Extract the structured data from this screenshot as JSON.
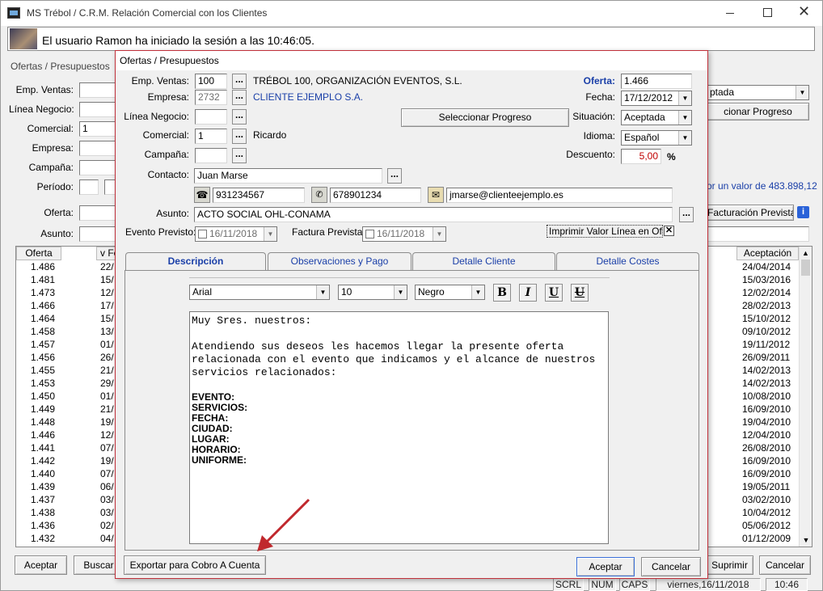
{
  "window": {
    "title": "MS Trébol / C.R.M. Relación Comercial con los  Clientes"
  },
  "banner": {
    "message": "El usuario Ramon ha iniciado la sesión a las 10:46:05."
  },
  "back": {
    "section_title": "Ofertas / Presupuestos",
    "labels": {
      "emp_ventas": "Emp. Ventas:",
      "linea_negocio": "Línea Negocio:",
      "comercial": "Comercial:",
      "empresa": "Empresa:",
      "campana": "Campaña:",
      "periodo": "Período:",
      "oferta": "Oferta:",
      "asunto": "Asunto:"
    },
    "comercial_value": "1",
    "situacion_partial": "ptada",
    "progreso_partial": "cionar Progreso",
    "total_text": "or un valor de 483.898,12",
    "facturacion_button": "Facturación Prevista",
    "columns": {
      "oferta": "Oferta",
      "fecha_partial": "v Fe",
      "aceptacion": "Aceptación"
    },
    "rows": [
      {
        "oferta": "1.486",
        "fecha": "22/",
        "aceptacion": "24/04/2014"
      },
      {
        "oferta": "1.481",
        "fecha": "15/",
        "aceptacion": "15/03/2016"
      },
      {
        "oferta": "1.473",
        "fecha": "12/",
        "aceptacion": "12/02/2014"
      },
      {
        "oferta": "1.466",
        "fecha": "17/",
        "aceptacion": "28/02/2013"
      },
      {
        "oferta": "1.464",
        "fecha": "15/",
        "aceptacion": "15/10/2012"
      },
      {
        "oferta": "1.458",
        "fecha": "13/",
        "aceptacion": "09/10/2012"
      },
      {
        "oferta": "1.457",
        "fecha": "01/",
        "aceptacion": "19/11/2012"
      },
      {
        "oferta": "1.456",
        "fecha": "26/",
        "aceptacion": "26/09/2011"
      },
      {
        "oferta": "1.455",
        "fecha": "21/",
        "aceptacion": "14/02/2013"
      },
      {
        "oferta": "1.453",
        "fecha": "29/",
        "aceptacion": "14/02/2013"
      },
      {
        "oferta": "1.450",
        "fecha": "01/",
        "aceptacion": "10/08/2010"
      },
      {
        "oferta": "1.449",
        "fecha": "21/",
        "aceptacion": "16/09/2010"
      },
      {
        "oferta": "1.448",
        "fecha": "19/",
        "aceptacion": "19/04/2010"
      },
      {
        "oferta": "1.446",
        "fecha": "12/",
        "aceptacion": "12/04/2010"
      },
      {
        "oferta": "1.441",
        "fecha": "07/",
        "aceptacion": "26/08/2010"
      },
      {
        "oferta": "1.442",
        "fecha": "19/",
        "aceptacion": "16/09/2010"
      },
      {
        "oferta": "1.440",
        "fecha": "07/",
        "aceptacion": "16/09/2010"
      },
      {
        "oferta": "1.439",
        "fecha": "06/",
        "aceptacion": "19/05/2011"
      },
      {
        "oferta": "1.437",
        "fecha": "03/",
        "aceptacion": "03/02/2010"
      },
      {
        "oferta": "1.438",
        "fecha": "03/",
        "aceptacion": "10/04/2012"
      },
      {
        "oferta": "1.436",
        "fecha": "02/",
        "aceptacion": "05/06/2012"
      },
      {
        "oferta": "1.432",
        "fecha": "04/",
        "aceptacion": "01/12/2009"
      }
    ],
    "buttons": {
      "aceptar": "Aceptar",
      "buscar": "Buscar",
      "suprimir": "Suprimir",
      "cancelar": "Cancelar"
    }
  },
  "status": {
    "scrl": "SCRL",
    "num": "NUM",
    "caps": "CAPS",
    "date": "viernes,16/11/2018",
    "time": "10:46"
  },
  "dialog": {
    "title": "Ofertas / Presupuestos",
    "labels": {
      "emp_ventas": "Emp. Ventas:",
      "empresa": "Empresa:",
      "linea_negocio": "Línea Negocio:",
      "comercial": "Comercial:",
      "campana": "Campaña:",
      "contacto": "Contacto:",
      "asunto": "Asunto:",
      "evento_previsto": "Evento Previsto:",
      "factura_prevista": "Factura Prevista:",
      "oferta": "Oferta:",
      "fecha": "Fecha:",
      "situacion": "Situación:",
      "idioma": "Idioma:",
      "descuento": "Descuento:"
    },
    "emp_ventas_code": "100",
    "emp_ventas_name": "TRÉBOL 100, ORGANIZACIÓN EVENTOS, S.L.",
    "empresa_code": "2732",
    "empresa_name": "CLIENTE EJEMPLO S.A.",
    "comercial_code": "1",
    "comercial_name": "Ricardo",
    "contacto": "Juan Marse",
    "phone": "931234567",
    "mobile": "678901234",
    "email": "jmarse@clienteejemplo.es",
    "asunto": "ACTO SOCIAL OHL-CONAMA",
    "evento_date": "16/11/2018",
    "factura_date": "16/11/2018",
    "oferta_num": "1.466",
    "fecha": "17/12/2012",
    "situacion": "Aceptada",
    "idioma": "Español",
    "descuento": "5,00",
    "percent_sign": "%",
    "seleccionar_progreso": "Seleccionar Progreso",
    "imprimir_valor": "Imprimir Valor Línea en Oferta",
    "tabs": [
      "Descripción",
      "Observaciones y Pago",
      "Detalle Cliente",
      "Detalle Costes"
    ],
    "editor": {
      "font": "Arial",
      "size": "10",
      "color": "Negro",
      "bold": "B",
      "italic": "I",
      "underline": "U",
      "strike": "U",
      "text_lines": [
        "Muy Sres. nuestros:",
        "",
        "Atendiendo sus deseos les hacemos llegar la presente oferta",
        "relacionada con el evento que indicamos y el alcance de nuestros",
        "servicios relacionados:",
        ""
      ],
      "bold_lines": [
        "EVENTO:",
        "SERVICIOS:",
        "FECHA:",
        "CIUDAD:",
        "LUGAR:",
        "HORARIO:",
        "UNIFORME:"
      ]
    },
    "buttons": {
      "exportar": "Exportar para Cobro A Cuenta",
      "aceptar": "Aceptar",
      "cancelar": "Cancelar"
    }
  },
  "colors": {
    "accent_blue": "#0000cc",
    "arrow_red": "#c0282d",
    "dialog_border": "#c0303a",
    "descuento_red": "#c00000"
  }
}
